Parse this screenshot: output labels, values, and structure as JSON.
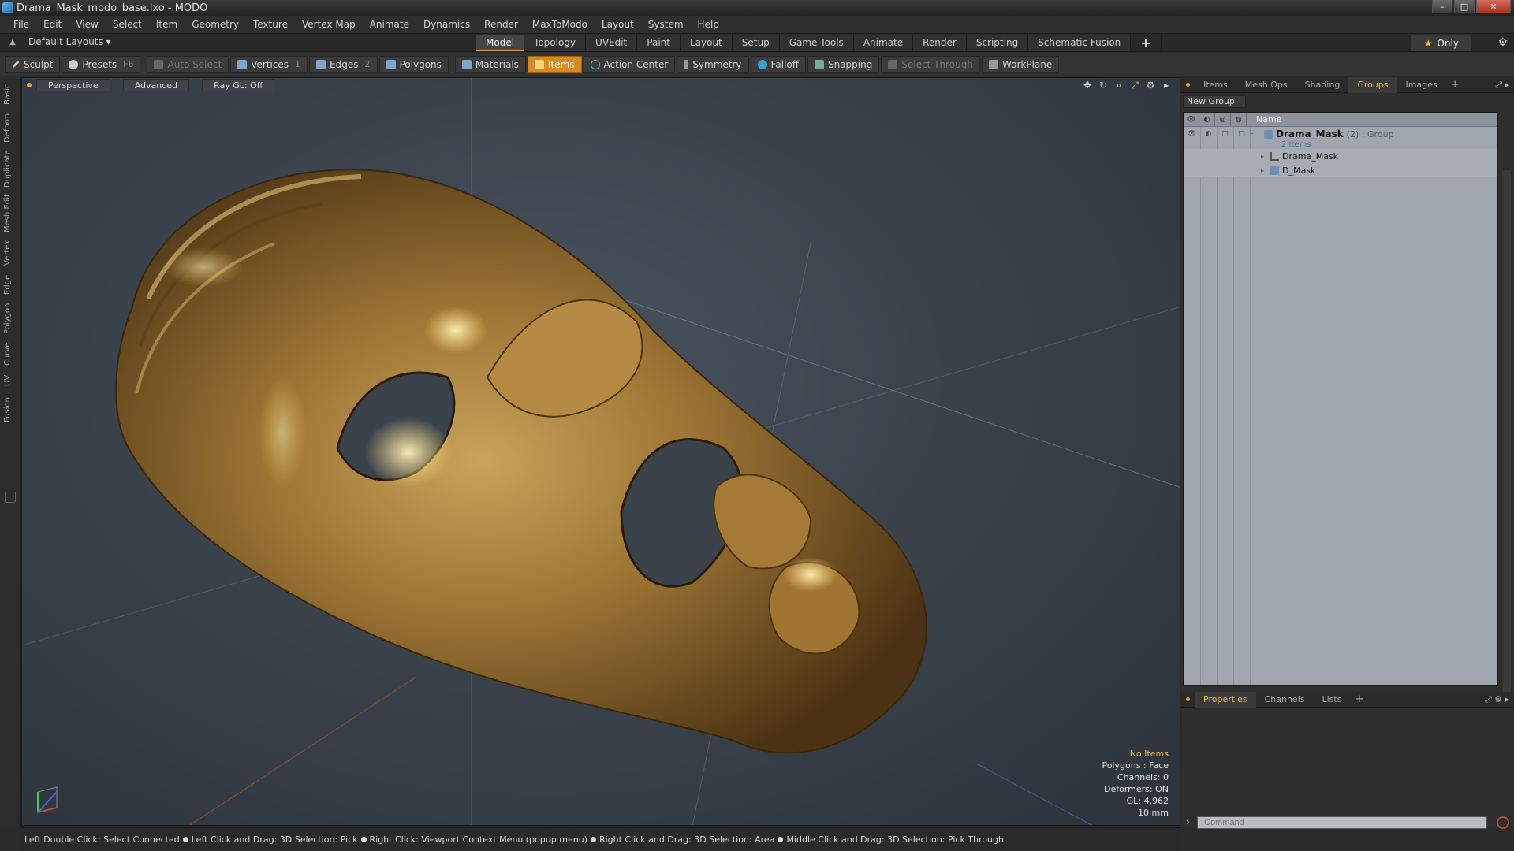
{
  "window": {
    "title": "Drama_Mask_modo_base.lxo - MODO"
  },
  "menu": [
    "File",
    "Edit",
    "View",
    "Select",
    "Item",
    "Geometry",
    "Texture",
    "Vertex Map",
    "Animate",
    "Dynamics",
    "Render",
    "MaxToModo",
    "Layout",
    "System",
    "Help"
  ],
  "layouts": {
    "label": "Default Layouts ▾"
  },
  "layout_tabs": [
    "Model",
    "Topology",
    "UVEdit",
    "Paint",
    "Layout",
    "Setup",
    "Game Tools",
    "Animate",
    "Render",
    "Scripting",
    "Schematic Fusion"
  ],
  "layout_tabs_active": "Model",
  "only_label": "Only",
  "toolbar": {
    "sculpt": "Sculpt",
    "presets": "Presets",
    "presets_key": "F6",
    "auto_select": "Auto Select",
    "vertices": "Vertices",
    "vertices_key": "1",
    "edges": "Edges",
    "edges_key": "2",
    "polygons": "Polygons",
    "materials": "Materials",
    "items": "Items",
    "action_center": "Action Center",
    "symmetry": "Symmetry",
    "falloff": "Falloff",
    "snapping": "Snapping",
    "select_through": "Select Through",
    "workplane": "WorkPlane"
  },
  "left_tabs": [
    "Basic",
    "Deform",
    "Duplicate",
    "Mesh Edit",
    "Vertex",
    "Edge",
    "Polygon",
    "Curve",
    "UV",
    "Fusion"
  ],
  "viewport": {
    "perspective": "Perspective",
    "advanced": "Advanced",
    "raygl": "Ray GL: Off",
    "info": {
      "no_items": "No Items",
      "polygons": "Polygons : Face",
      "channels": "Channels: 0",
      "deformers": "Deformers: ON",
      "gl": "GL: 4,962",
      "scale": "10 mm"
    }
  },
  "right_panel": {
    "tabs": [
      "Items",
      "Mesh Ops",
      "Shading",
      "Groups",
      "Images"
    ],
    "active_tab": "Groups",
    "new_group": "New Group",
    "name_header": "Name",
    "group": {
      "name": "Drama_Mask",
      "count": "(2) : Group",
      "sub": "2 Items",
      "children": [
        "Drama_Mask",
        "D_Mask"
      ]
    },
    "bottom_tabs": [
      "Properties",
      "Channels",
      "Lists"
    ],
    "bottom_active": "Properties",
    "command_placeholder": "Command"
  },
  "status": [
    "Left Double Click: Select Connected",
    "Left Click and Drag: 3D Selection: Pick",
    "Right Click: Viewport Context Menu (popup menu)",
    "Right Click and Drag: 3D Selection: Area",
    "Middle Click and Drag: 3D Selection: Pick Through"
  ]
}
